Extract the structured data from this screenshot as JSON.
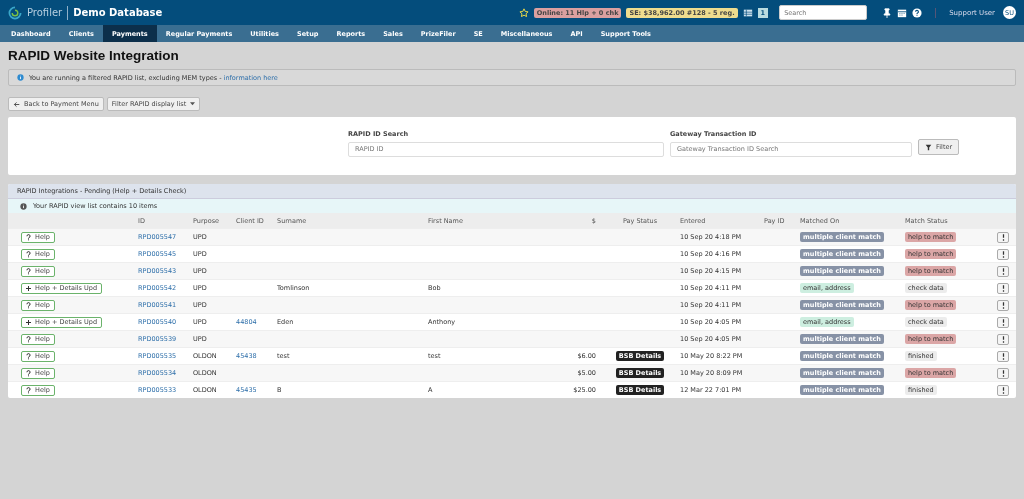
{
  "header": {
    "brand": "Profiler",
    "database": "Demo Database",
    "online_badge": "Online: 11 Hlp + 0 chk",
    "se_badge": "SE: $38,962.00 #128 - 5 reg.",
    "list_count": "1",
    "search": {
      "placeholder": "Search"
    },
    "user": "Support User",
    "avatar": "SU"
  },
  "nav": [
    {
      "label": "Dashboard",
      "selected": false
    },
    {
      "label": "Clients",
      "selected": false
    },
    {
      "label": "Payments",
      "selected": true
    },
    {
      "label": "Regular Payments",
      "selected": false
    },
    {
      "label": "Utilities",
      "selected": false
    },
    {
      "label": "Setup",
      "selected": false
    },
    {
      "label": "Reports",
      "selected": false
    },
    {
      "label": "Sales",
      "selected": false
    },
    {
      "label": "PrizeFiler",
      "selected": false
    },
    {
      "label": "SE",
      "selected": false
    },
    {
      "label": "Miscellaneous",
      "selected": false
    },
    {
      "label": "API",
      "selected": false
    },
    {
      "label": "Support Tools",
      "selected": false
    }
  ],
  "page_title": "RAPID Website Integration",
  "notice": {
    "text": "You are running a filtered RAPID list, excluding MEM types - ",
    "link": "information here"
  },
  "buttons": {
    "back": "Back to Payment Menu",
    "filter_list": "Filter RAPID display list"
  },
  "filters": {
    "rapid_label": "RAPID ID Search",
    "rapid_placeholder": "RAPID ID",
    "gateway_label": "Gateway Transaction ID",
    "gateway_placeholder": "Gateway Transaction ID Search",
    "filter_button": "Filter"
  },
  "panel": {
    "title": "RAPID Integrations - Pending (Help + Details Check)",
    "info": "Your RAPID view list contains 10 items"
  },
  "table": {
    "columns": [
      "ID",
      "Purpose",
      "Client ID",
      "Surname",
      "First Name",
      "$",
      "Pay Status",
      "Entered",
      "Pay ID",
      "Matched On",
      "Match Status"
    ],
    "rows": [
      {
        "action": {
          "kind": "help",
          "label": "Help"
        },
        "id": "RPD005547",
        "purpose": "UPD",
        "entered": "10 Sep 20 4:18 PM",
        "matched": {
          "kind": "multiple",
          "text": "multiple client match"
        },
        "status": {
          "kind": "help",
          "text": "help to match"
        }
      },
      {
        "action": {
          "kind": "help",
          "label": "Help"
        },
        "id": "RPD005545",
        "purpose": "UPD",
        "entered": "10 Sep 20 4:16 PM",
        "matched": {
          "kind": "multiple",
          "text": "multiple client match"
        },
        "status": {
          "kind": "help",
          "text": "help to match"
        }
      },
      {
        "action": {
          "kind": "help",
          "label": "Help"
        },
        "id": "RPD005543",
        "purpose": "UPD",
        "entered": "10 Sep 20 4:15 PM",
        "matched": {
          "kind": "multiple",
          "text": "multiple client match"
        },
        "status": {
          "kind": "help",
          "text": "help to match"
        }
      },
      {
        "action": {
          "kind": "details",
          "label": "Help + Details Upd"
        },
        "id": "RPD005542",
        "purpose": "UPD",
        "surname": "Tomlinson",
        "first_name": "Bob",
        "entered": "10 Sep 20 4:11 PM",
        "matched": {
          "kind": "fields",
          "text": "email, address"
        },
        "status": {
          "kind": "check",
          "text": "check data"
        }
      },
      {
        "action": {
          "kind": "help",
          "label": "Help"
        },
        "id": "RPD005541",
        "purpose": "UPD",
        "entered": "10 Sep 20 4:11 PM",
        "matched": {
          "kind": "multiple",
          "text": "multiple client match"
        },
        "status": {
          "kind": "help",
          "text": "help to match"
        }
      },
      {
        "action": {
          "kind": "details",
          "label": "Help + Details Upd"
        },
        "id": "RPD005540",
        "purpose": "UPD",
        "client_id": "44804",
        "surname": "Eden",
        "first_name": "Anthony",
        "entered": "10 Sep 20 4:05 PM",
        "matched": {
          "kind": "fields",
          "text": "email, address"
        },
        "status": {
          "kind": "check",
          "text": "check data"
        }
      },
      {
        "action": {
          "kind": "help",
          "label": "Help"
        },
        "id": "RPD005539",
        "purpose": "UPD",
        "entered": "10 Sep 20 4:05 PM",
        "matched": {
          "kind": "multiple",
          "text": "multiple client match"
        },
        "status": {
          "kind": "help",
          "text": "help to match"
        }
      },
      {
        "action": {
          "kind": "help",
          "label": "Help"
        },
        "id": "RPD005535",
        "purpose": "OLDON",
        "client_id": "45438",
        "surname": "test",
        "first_name": "test",
        "amount": "$6.00",
        "pay_status": "BSB Details",
        "entered": "10 May 20 8:22 PM",
        "matched": {
          "kind": "multiple",
          "text": "multiple client match"
        },
        "status": {
          "kind": "finished",
          "text": "finished"
        }
      },
      {
        "action": {
          "kind": "help",
          "label": "Help"
        },
        "id": "RPD005534",
        "purpose": "OLDON",
        "amount": "$5.00",
        "pay_status": "BSB Details",
        "entered": "10 May 20 8:09 PM",
        "matched": {
          "kind": "multiple",
          "text": "multiple client match"
        },
        "status": {
          "kind": "help",
          "text": "help to match"
        }
      },
      {
        "action": {
          "kind": "help",
          "label": "Help"
        },
        "id": "RPD005533",
        "purpose": "OLDON",
        "client_id": "45435",
        "surname": "B",
        "first_name": "A",
        "amount": "$25.00",
        "pay_status": "BSB Details",
        "entered": "12 Mar 22 7:01 PM",
        "matched": {
          "kind": "multiple",
          "text": "multiple client match"
        },
        "status": {
          "kind": "finished",
          "text": "finished"
        }
      }
    ]
  }
}
